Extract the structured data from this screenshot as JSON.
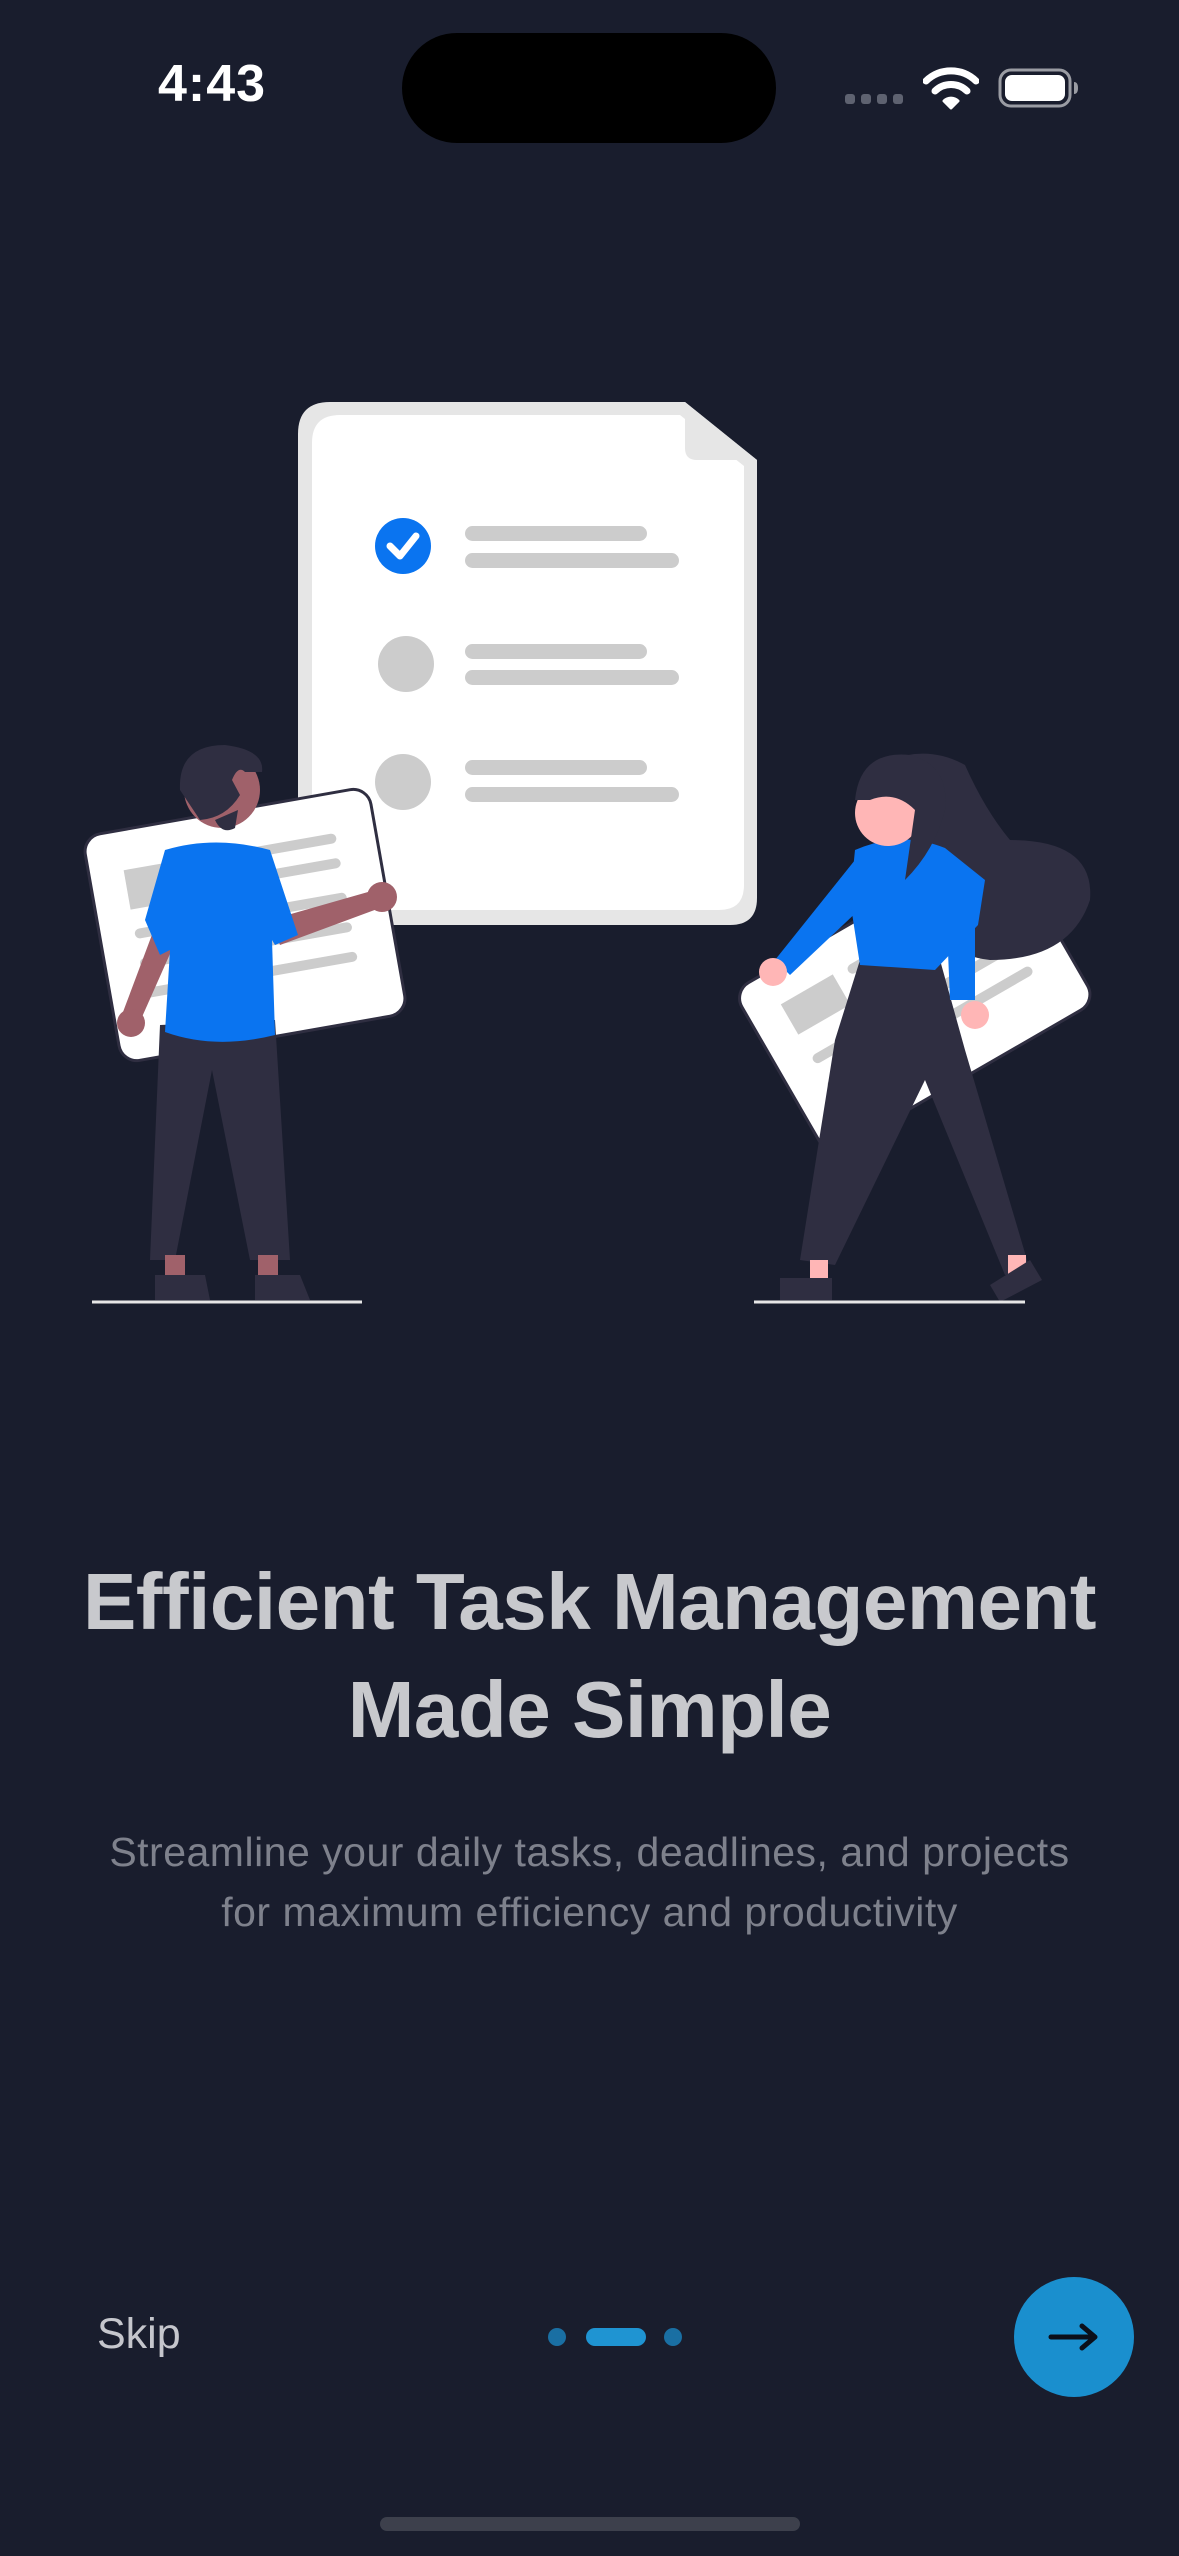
{
  "status_bar": {
    "time": "4:43",
    "icons": [
      "cellular-signal-icon",
      "wifi-icon",
      "battery-icon"
    ]
  },
  "onboarding": {
    "illustration": "task-checklist-illustration",
    "headline_line1": "Efficient Task Management",
    "headline_line2": "Made Simple",
    "subtitle_line1": "Streamline your daily tasks, deadlines, and projects",
    "subtitle_line2": "for maximum efficiency and productivity"
  },
  "footer": {
    "skip_label": "Skip",
    "page_count": 3,
    "current_page": 2,
    "next_icon": "arrow-right-icon"
  },
  "colors": {
    "background": "#191d2d",
    "accent": "#1a8fce",
    "illustration_blue": "#0a74f0",
    "headline": "#c8c9cd",
    "subtitle": "#7e818c"
  }
}
